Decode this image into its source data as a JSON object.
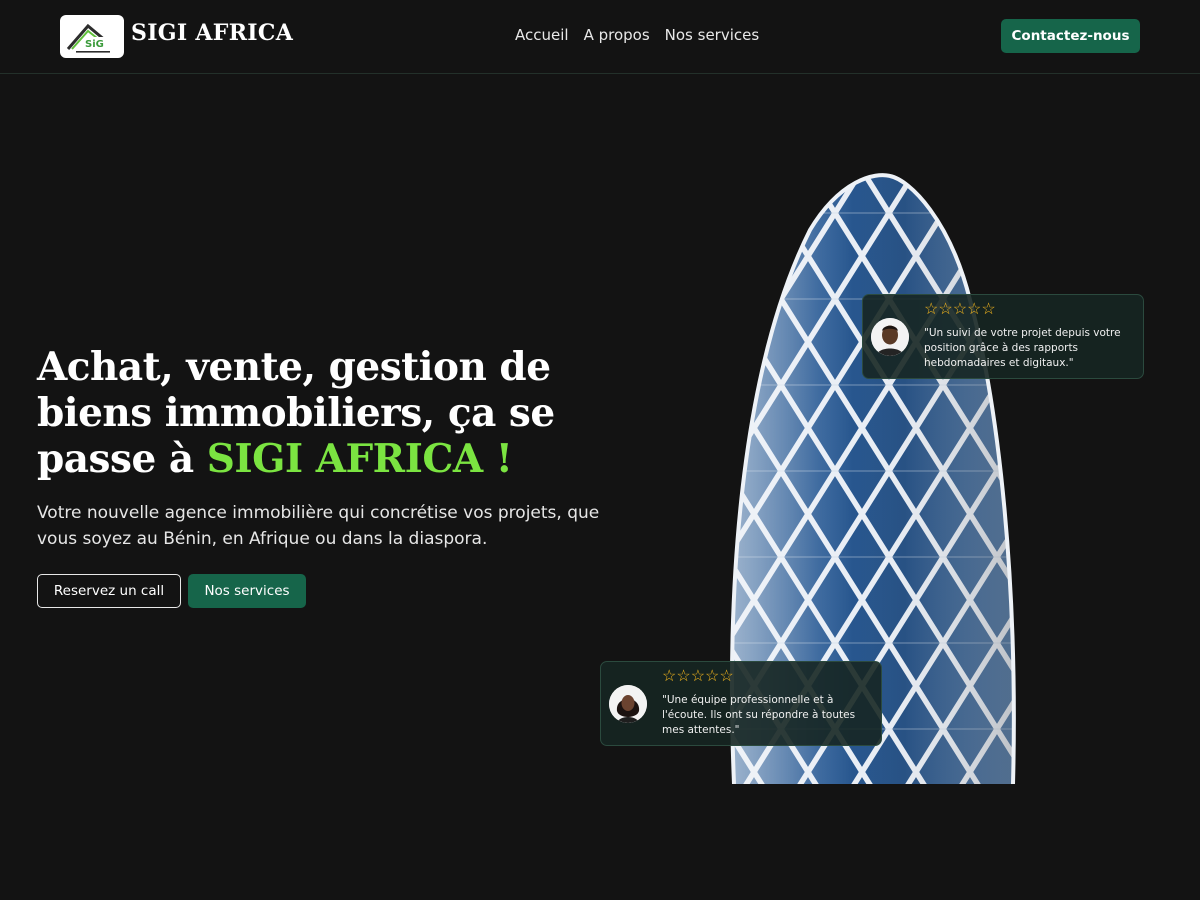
{
  "colors": {
    "background": "#131313",
    "accent_green": "#7be441",
    "button_green": "#16654a",
    "star_gold": "#f2b51d"
  },
  "nav": {
    "brand": "SIGI AFRICA",
    "links": [
      "Accueil",
      "A propos",
      "Nos services"
    ],
    "cta": "Contactez-nous"
  },
  "hero": {
    "title_main": "Achat, vente, gestion de biens immobiliers, ça se passe à ",
    "title_accent": "SIGI AFRICA !",
    "subtitle": "Votre nouvelle agence immobilière qui concrétise vos projets, que vous soyez au Bénin, en Afrique ou dans la diaspora.",
    "btn_call": "Reservez un call",
    "btn_services": "Nos services"
  },
  "reviews": [
    {
      "stars": "☆☆☆☆☆",
      "rating_out_of_5": 5,
      "avatar": "man-avatar",
      "quote": "\"Un suivi de votre projet depuis votre position grâce à des rapports hebdomadaires et digitaux.\""
    },
    {
      "stars": "☆☆☆☆☆",
      "rating_out_of_5": 5,
      "avatar": "woman-avatar",
      "quote": "\"Une équipe professionnelle et à l'écoute. Ils ont su répondre à toutes mes attentes.\""
    }
  ]
}
